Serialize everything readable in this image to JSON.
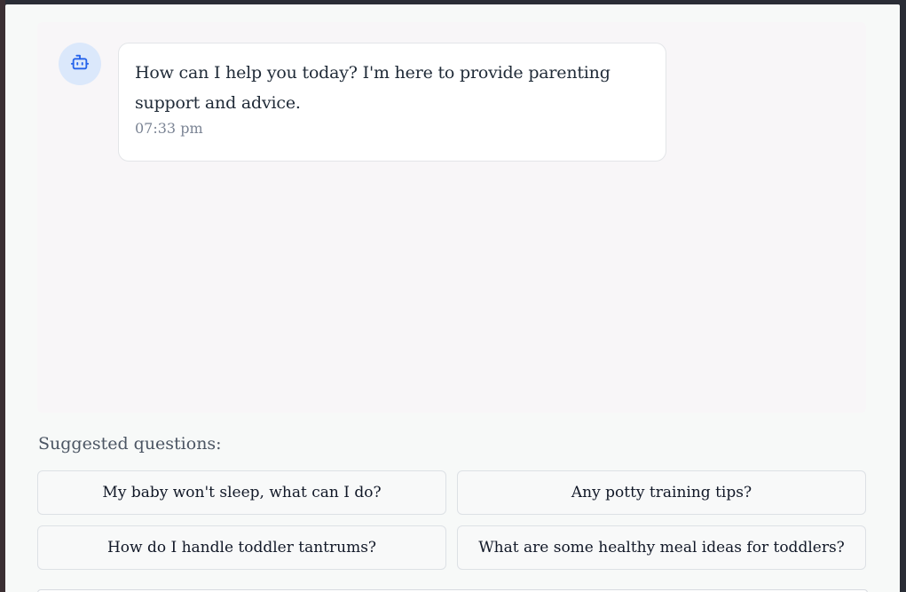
{
  "chat": {
    "messages": [
      {
        "sender_icon": "robot-icon",
        "text": "How can I help you today? I'm here to provide parenting support and advice.",
        "time": "07:33 pm"
      }
    ]
  },
  "suggestions": {
    "title": "Suggested questions:",
    "items": [
      {
        "label": "My baby won't sleep, what can I do?"
      },
      {
        "label": "Any potty training tips?"
      },
      {
        "label": "How do I handle toddler tantrums?"
      },
      {
        "label": "What are some healthy meal ideas for toddlers?"
      }
    ]
  },
  "colors": {
    "accent": "#2563eb",
    "avatar_bg": "#dbe8fb",
    "modal_bg": "#f7f9f8"
  }
}
